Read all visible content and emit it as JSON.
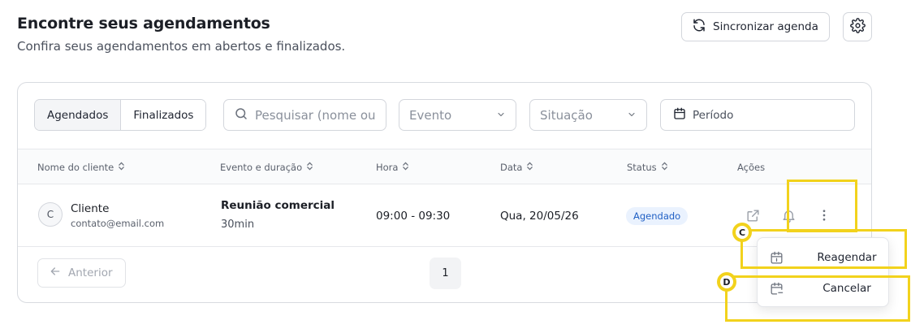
{
  "header": {
    "title": "Encontre seus agendamentos",
    "subtitle": "Confira seus agendamentos em abertos e finalizados.",
    "sync_label": "Sincronizar agenda"
  },
  "filters": {
    "tabs": [
      "Agendados",
      "Finalizados"
    ],
    "active_tab": "Agendados",
    "search_placeholder": "Pesquisar (nome ou",
    "event_placeholder": "Evento",
    "status_placeholder": "Situação",
    "period_label": "Período"
  },
  "table": {
    "columns": [
      "Nome do cliente",
      "Evento e duração",
      "Hora",
      "Data",
      "Status",
      "Ações"
    ],
    "rows": [
      {
        "avatar_initial": "C",
        "client_name": "Cliente",
        "client_email": "contato@email.com",
        "event": "Reunião comercial",
        "duration": "30min",
        "time": "09:00 - 09:30",
        "date": "Qua, 20/05/26",
        "status": "Agendado"
      }
    ]
  },
  "pagination": {
    "prev_label": "Anterior",
    "current_page": "1"
  },
  "actions_menu": {
    "items": [
      "Reagendar",
      "Cancelar"
    ]
  },
  "annotations": {
    "markers": [
      "C",
      "D"
    ],
    "highlight_color": "#f2d21c"
  },
  "colors": {
    "badge_bg": "#eaf2fe",
    "badge_text": "#1f5fc4"
  }
}
